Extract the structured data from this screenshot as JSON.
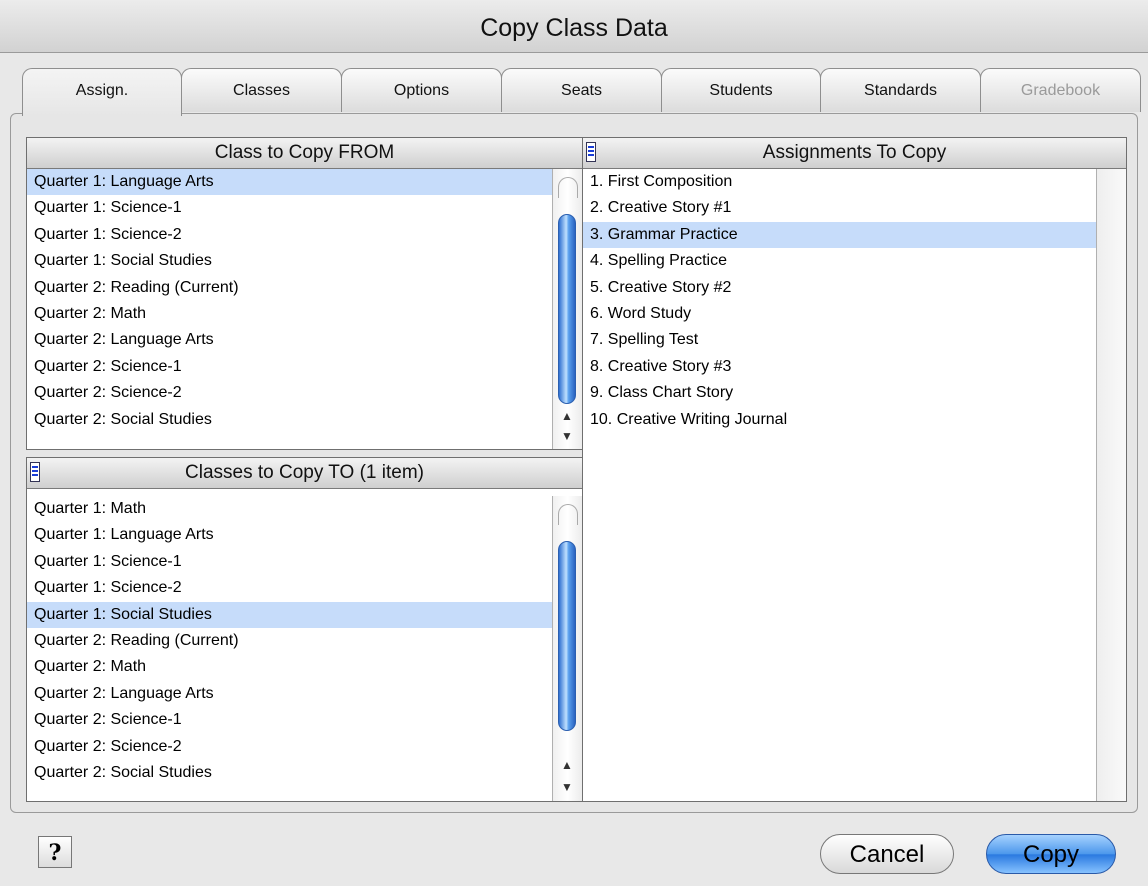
{
  "window": {
    "title": "Copy Class Data"
  },
  "tabs": [
    {
      "label": "Assign.",
      "active": true
    },
    {
      "label": "Classes"
    },
    {
      "label": "Options"
    },
    {
      "label": "Seats"
    },
    {
      "label": "Students"
    },
    {
      "label": "Standards"
    },
    {
      "label": "Gradebook",
      "disabled": true
    }
  ],
  "from_list": {
    "header": "Class to Copy FROM",
    "items": [
      "Quarter 1: Language Arts",
      "Quarter 1: Science-1",
      "Quarter 1: Science-2",
      "Quarter 1: Social Studies",
      "Quarter 2: Reading (Current)",
      "Quarter 2: Math",
      "Quarter 2: Language Arts",
      "Quarter 2: Science-1",
      "Quarter 2: Science-2",
      "Quarter 2: Social Studies"
    ],
    "selected_index": 0
  },
  "to_list": {
    "header": "Classes to Copy TO  (1 item)",
    "items": [
      "Quarter 1: Math",
      "Quarter 1: Language Arts",
      "Quarter 1: Science-1",
      "Quarter 1: Science-2",
      "Quarter 1: Social Studies",
      "Quarter 2: Reading (Current)",
      "Quarter 2: Math",
      "Quarter 2: Language Arts",
      "Quarter 2: Science-1",
      "Quarter 2: Science-2",
      "Quarter 2: Social Studies"
    ],
    "selected_index": 4
  },
  "assignments_list": {
    "header": "Assignments To Copy",
    "items": [
      "1. First Composition",
      "2. Creative Story #1",
      "3. Grammar Practice",
      "4. Spelling Practice",
      "5. Creative Story #2",
      "6. Word Study",
      "7. Spelling Test",
      "8. Creative Story #3",
      "9. Class Chart Story",
      "10. Creative Writing Journal"
    ],
    "selected_index": 2
  },
  "buttons": {
    "help": "?",
    "cancel": "Cancel",
    "copy": "Copy"
  },
  "icons": {
    "sort": "sort-menu-icon",
    "up": "up-arrow-icon",
    "down": "down-arrow-icon"
  },
  "colors": {
    "selection": "#c6dcfa",
    "default_button": "#4c97ec"
  }
}
